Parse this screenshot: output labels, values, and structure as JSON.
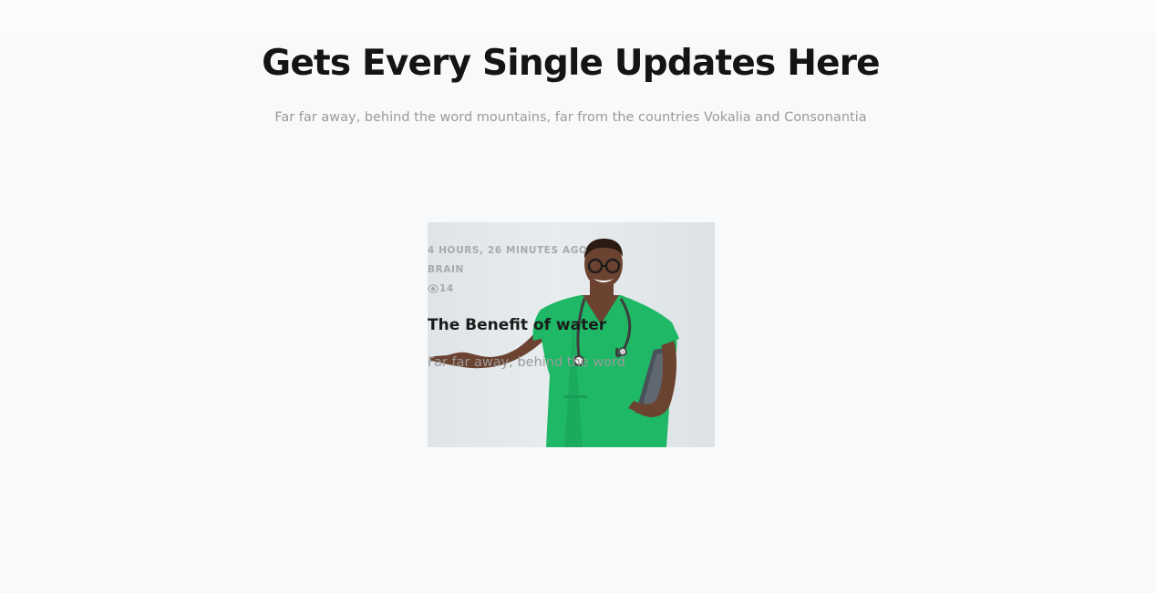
{
  "section": {
    "heading": "Gets Every Single Updates Here",
    "subheading": "Far far away, behind the word mountains, far from the countries Vokalia and Consonantia"
  },
  "post": {
    "image_alt": "Smiling doctor in green scrubs with stethoscope holding a tablet",
    "time_ago": "4 HOURS, 26 MINUTES AGO",
    "category": "BRAIN",
    "views_icon": "eye-icon",
    "views": "14",
    "title": "The Benefit of water",
    "excerpt": "Far far away, behind the word"
  },
  "colors": {
    "background": "#f8f9fb",
    "heading": "#141414",
    "muted": "#9a9a9a",
    "meta": "#a9a9a9",
    "scrubs": "#1fb866"
  }
}
